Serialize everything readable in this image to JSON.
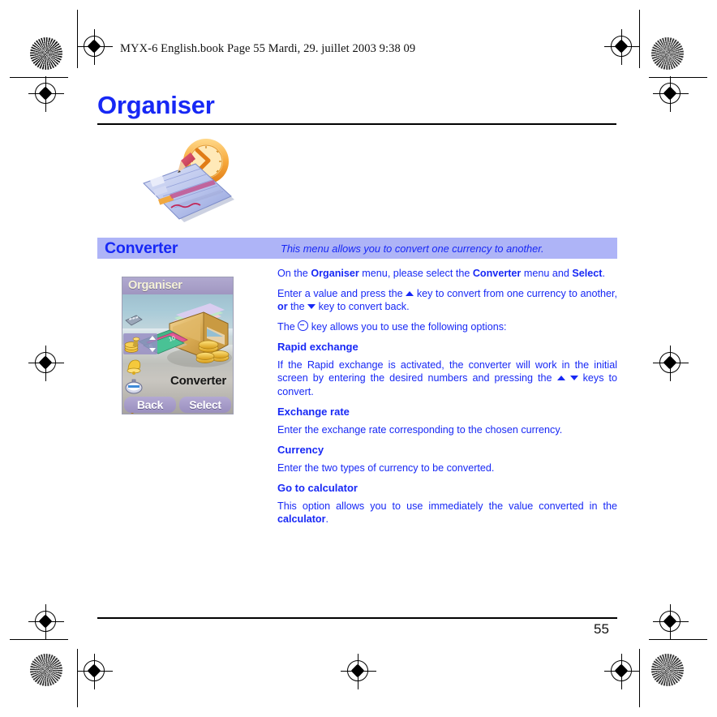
{
  "page": {
    "running_header": "MYX-6 English.book  Page 55  Mardi, 29. juillet 2003  9:38 09",
    "title": "Organiser",
    "page_number": "55",
    "colors": {
      "text_blue": "#1728f5",
      "section_bar_bg": "#aeb4f7",
      "phone_titlebar": "#a89fc8",
      "softkey": "#9a8fbf"
    }
  },
  "section": {
    "title": "Converter",
    "subtitle": "This menu allows you to convert one currency to another."
  },
  "phone": {
    "titlebar": "Organiser",
    "menu_label": "Converter",
    "softkey_left": "Back",
    "softkey_right": "Select",
    "rail_icons": [
      "calculator-icon",
      "converter-coins-icon",
      "alarm-bell-icon",
      "stopwatch-icon",
      "notepad-icon"
    ]
  },
  "content": {
    "intro": {
      "p1_a": "On the ",
      "p1_b": "Organiser",
      "p1_c": " menu, please select the ",
      "p1_d": "Converter",
      "p1_e": " menu and ",
      "p1_f": "Select",
      "p1_g": ".",
      "p2_a": "Enter a value and press the ",
      "p2_b": " key to convert from one currency to another, ",
      "p2_c": "or",
      "p2_d": " the ",
      "p2_e": " key to convert back.",
      "p3_a": "The ",
      "p3_b": " key allows you to use the following options:"
    },
    "options": [
      {
        "heading": "Rapid exchange",
        "body_a": "If the Rapid exchange is activated, the converter will work in the initial screen by entering the desired numbers and pressing the ",
        "body_b": " keys to convert."
      },
      {
        "heading": "Exchange rate",
        "body": "Enter the exchange rate corresponding to the chosen currency."
      },
      {
        "heading": "Currency",
        "body": "Enter the two types of currency to be converted."
      },
      {
        "heading": "Go to calculator",
        "body_a": "This option allows you to use immediately the value converted in the ",
        "body_b": "calculator",
        "body_c": "."
      }
    ]
  }
}
